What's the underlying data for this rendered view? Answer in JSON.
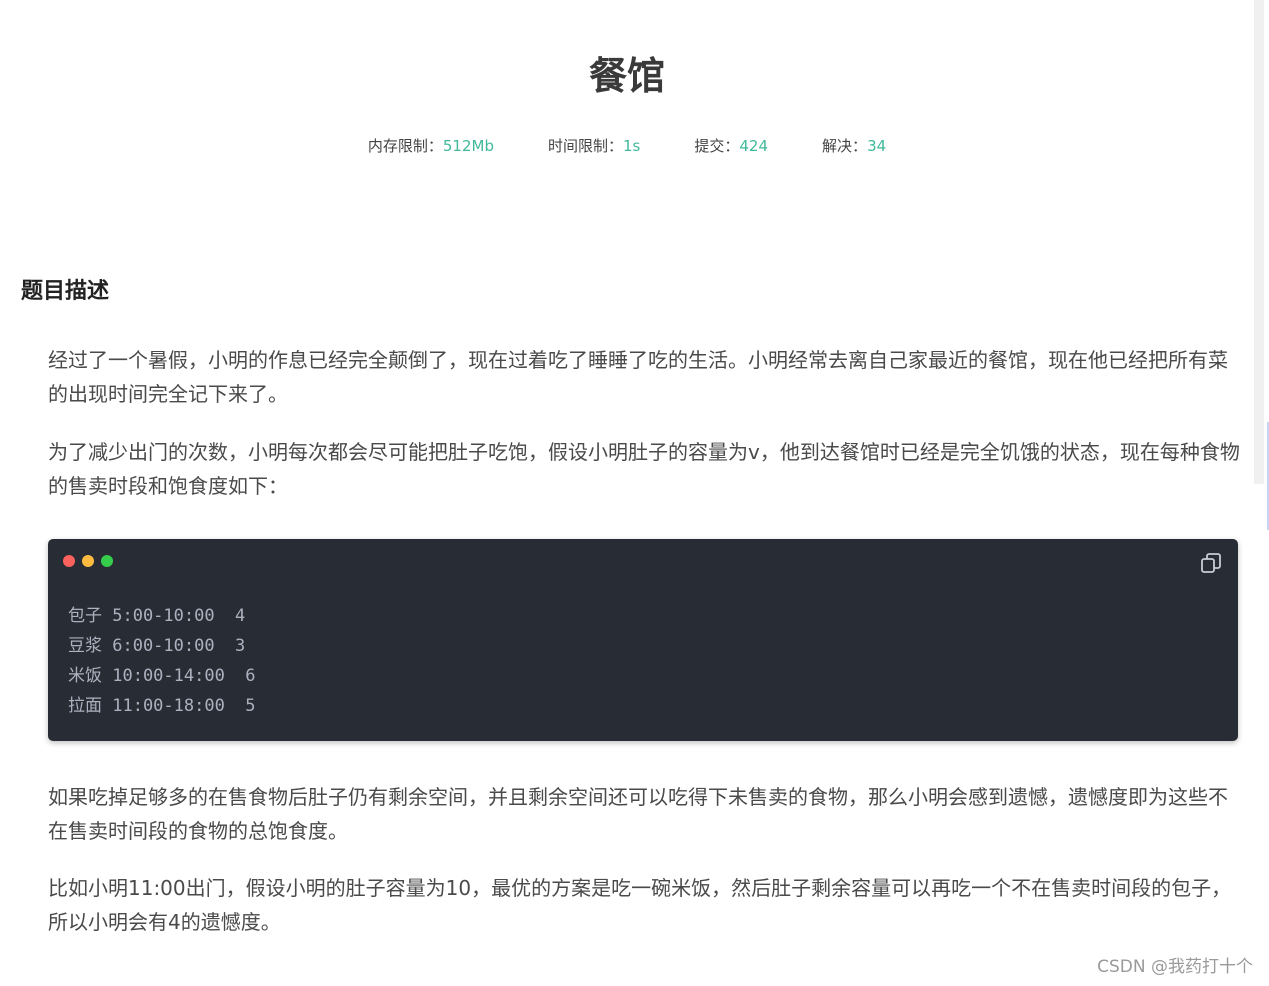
{
  "problem": {
    "title": "餐馆",
    "stats": [
      {
        "label": "内存限制",
        "sep": "：",
        "value": "512Mb"
      },
      {
        "label": "时间限制",
        "sep": "：",
        "value": "1s"
      },
      {
        "label": "提交",
        "sep": "：",
        "value": "424"
      },
      {
        "label": "解决",
        "sep": "：",
        "value": "34"
      }
    ]
  },
  "description": {
    "heading": "题目描述",
    "paragraphs": [
      "经过了一个暑假，小明的作息已经完全颠倒了，现在过着吃了睡睡了吃的生活。小明经常去离自己家最近的餐馆，现在他已经把所有菜的出现时间完全记下来了。",
      "为了减少出门的次数，小明每次都会尽可能把肚子吃饱，假设小明肚子的容量为v，他到达餐馆时已经是完全饥饿的状态，现在每种食物的售卖时段和饱食度如下："
    ],
    "code_lines": [
      "包子 5:00-10:00  4",
      "豆浆 6:00-10:00  3",
      "米饭 10:00-14:00  6",
      "拉面 11:00-18:00  5"
    ],
    "paragraphs_after": [
      "如果吃掉足够多的在售食物后肚子仍有剩余空间，并且剩余空间还可以吃得下未售卖的食物，那么小明会感到遗憾，遗憾度即为这些不在售卖时间段的食物的总饱食度。",
      "比如小明11:00出门，假设小明的肚子容量为10，最优的方案是吃一碗米饭，然后肚子剩余容量可以再吃一个不在售卖时间段的包子，所以小明会有4的遗憾度。"
    ]
  },
  "watermark": "CSDN @我药打十个",
  "colors": {
    "accent": "#3fb99a",
    "code_bg": "#282c34",
    "dot_red": "#fc625d",
    "dot_yellow": "#fdbc40",
    "dot_green": "#35cd4b"
  },
  "icons": {
    "copy": "copy-icon"
  }
}
